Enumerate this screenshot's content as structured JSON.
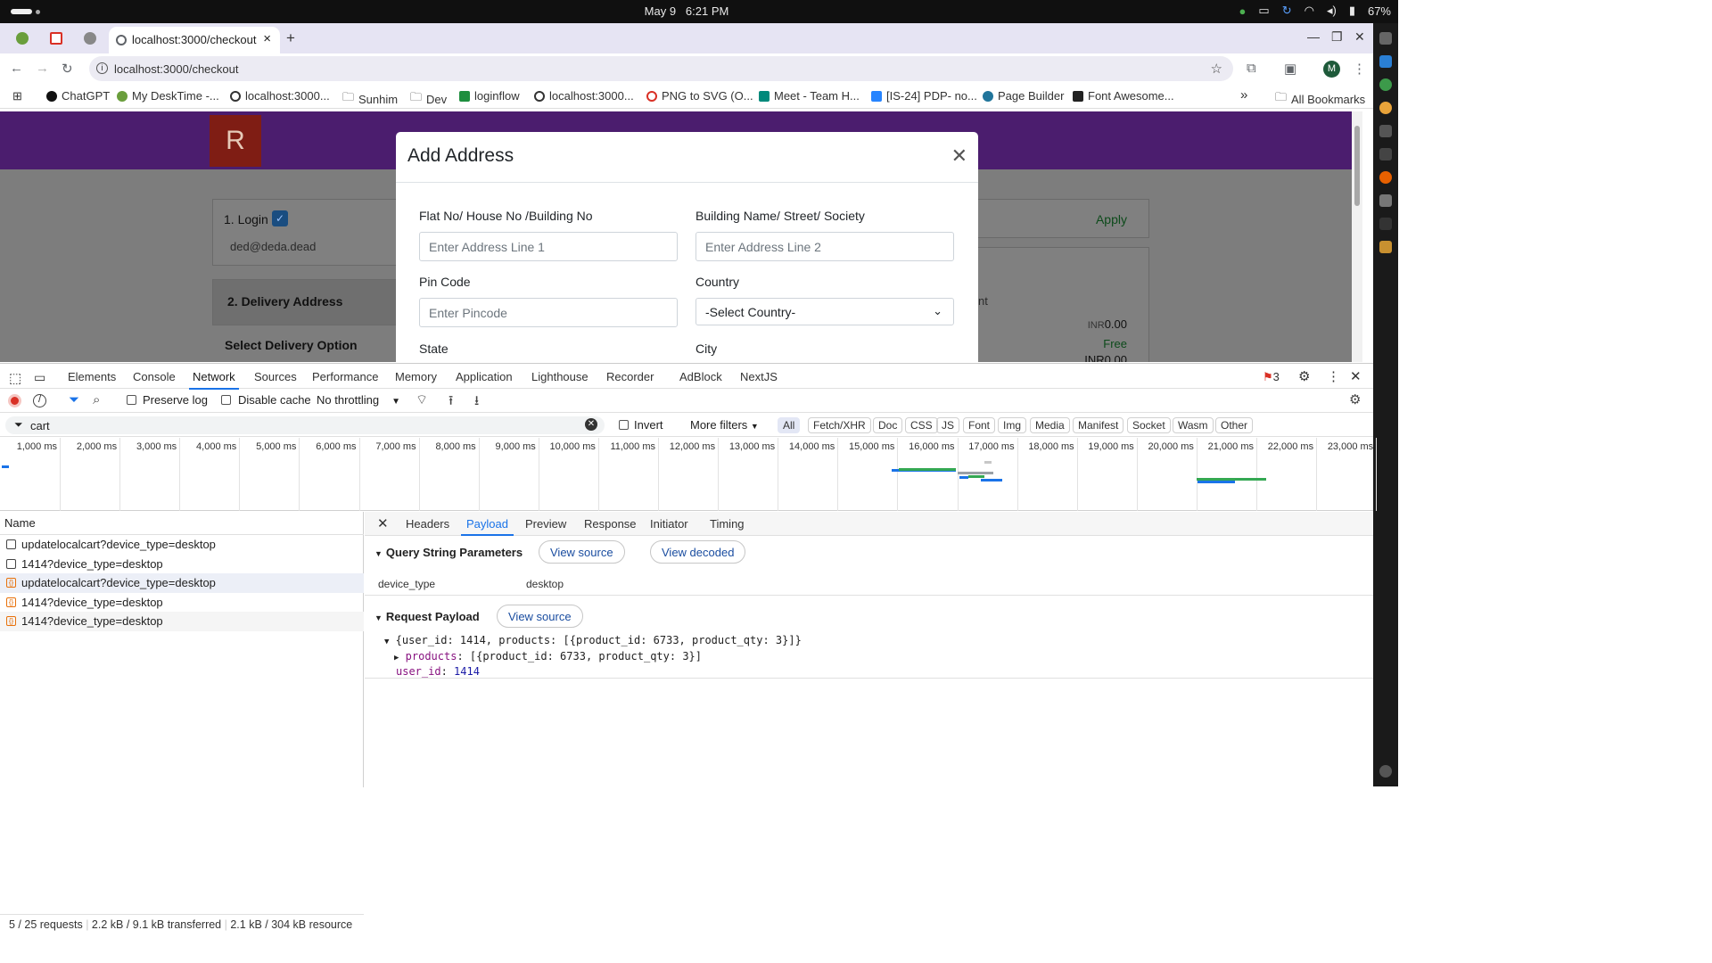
{
  "os": {
    "date": "May 9",
    "time": "6:21 PM",
    "battery": "67%"
  },
  "browser": {
    "tab_title": "localhost:3000/checkout",
    "new_tab": "+",
    "url": "localhost:3000/checkout",
    "bookmarks": [
      "ChatGPT",
      "My DeskTime -...",
      "localhost:3000...",
      "Sunhim",
      "Dev",
      "loginflow",
      "localhost:3000...",
      "PNG to SVG (O...",
      "Meet - Team H...",
      "[IS-24] PDP- no...",
      "Page Builder",
      "Font Awesome..."
    ],
    "all_bookmarks": "All Bookmarks",
    "more_bookmarks": "»"
  },
  "page": {
    "logo": "R",
    "login_title": "1. Login",
    "login_email": "ded@deda.dead",
    "delivery_title": "2. Delivery Address",
    "select_delivery": "Select Delivery Option",
    "apply": "Apply",
    "partial_text": "nt",
    "amount_prefix": "INR",
    "amount": "0.00",
    "free": "Free",
    "amount2": "INR0.00"
  },
  "modal": {
    "title": "Add Address",
    "close": "✕",
    "flat_label": "Flat No/ House No /Building No",
    "flat_placeholder": "Enter Address Line 1",
    "building_label": "Building Name/ Street/ Society",
    "building_placeholder": "Enter Address Line 2",
    "pin_label": "Pin Code",
    "pin_placeholder": "Enter Pincode",
    "country_label": "Country",
    "country_value": "-Select Country-",
    "state_label": "State",
    "city_label": "City"
  },
  "devtools": {
    "tabs": [
      "Elements",
      "Console",
      "Network",
      "Sources",
      "Performance",
      "Memory",
      "Application",
      "Lighthouse",
      "Recorder",
      "AdBlock",
      "NextJS"
    ],
    "error_count": "3",
    "preserve_log": "Preserve log",
    "disable_cache": "Disable cache",
    "throttling": "No throttling",
    "filter_value": "cart",
    "invert": "Invert",
    "more_filters": "More filters",
    "type_filters": [
      "All",
      "Fetch/XHR",
      "Doc",
      "CSS",
      "JS",
      "Font",
      "Img",
      "Media",
      "Manifest",
      "Socket",
      "Wasm",
      "Other"
    ],
    "timeline_ticks": [
      "1,000 ms",
      "2,000 ms",
      "3,000 ms",
      "4,000 ms",
      "5,000 ms",
      "6,000 ms",
      "7,000 ms",
      "8,000 ms",
      "9,000 ms",
      "10,000 ms",
      "11,000 ms",
      "12,000 ms",
      "13,000 ms",
      "14,000 ms",
      "15,000 ms",
      "16,000 ms",
      "17,000 ms",
      "18,000 ms",
      "19,000 ms",
      "20,000 ms",
      "21,000 ms",
      "22,000 ms",
      "23,000 ms"
    ],
    "name_header": "Name",
    "requests": [
      {
        "name": "updatelocalcart?device_type=desktop",
        "type": "doc"
      },
      {
        "name": "1414?device_type=desktop",
        "type": "doc"
      },
      {
        "name": "updatelocalcart?device_type=desktop",
        "type": "xhr"
      },
      {
        "name": "1414?device_type=desktop",
        "type": "xhr"
      },
      {
        "name": "1414?device_type=desktop",
        "type": "xhr"
      }
    ],
    "status": {
      "requests": "5 / 25 requests",
      "transferred": "2.2 kB / 9.1 kB transferred",
      "resources": "2.1 kB / 304 kB resource"
    },
    "detail_tabs": [
      "Headers",
      "Payload",
      "Preview",
      "Response",
      "Initiator",
      "Timing"
    ],
    "query_title": "Query String Parameters",
    "view_source": "View source",
    "view_decoded": "View decoded",
    "param_key": "device_type",
    "param_value": "desktop",
    "payload_title": "Request Payload",
    "payload_summary": "{user_id: 1414, products: [{product_id: 6733, product_qty: 3}]}",
    "payload_products_key": "products",
    "payload_products_val": "[{product_id: 6733, product_qty: 3}]",
    "payload_user_key": "user_id",
    "payload_user_val": "1414"
  }
}
